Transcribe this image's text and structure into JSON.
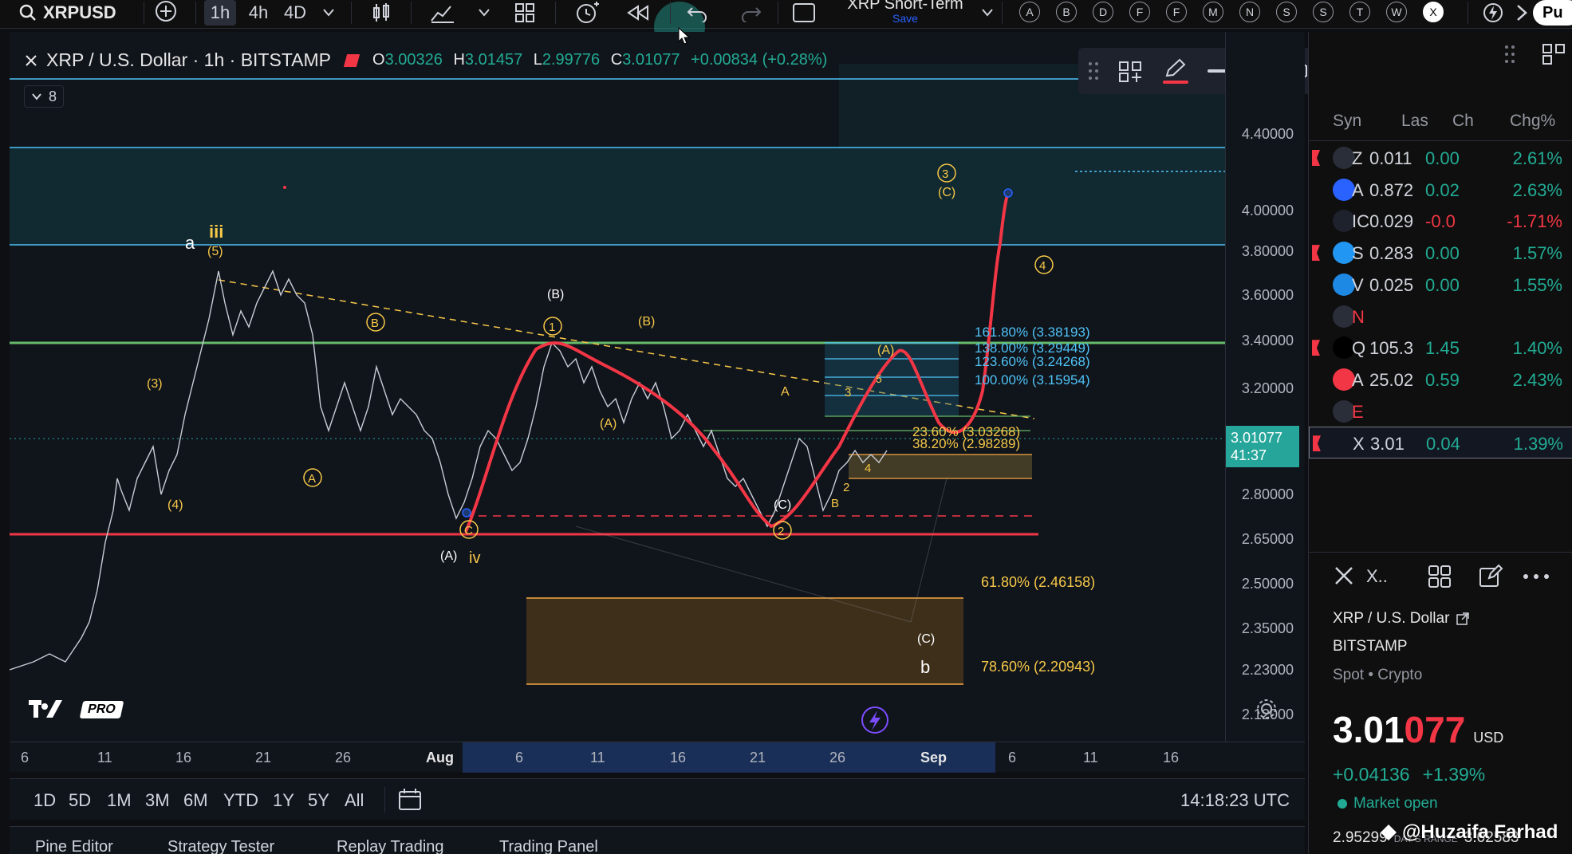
{
  "toolbar": {
    "symbol": "XRPUSD",
    "intervals": [
      "1h",
      "4h",
      "4D"
    ],
    "layout_name": "XRP Short-Term",
    "save_label": "Save",
    "letter_buttons": [
      "A",
      "B",
      "D",
      "F",
      "F",
      "M",
      "N",
      "S",
      "S",
      "T",
      "W",
      "X"
    ],
    "publish_label": "Pu"
  },
  "legend": {
    "title": "XRP / U.S. Dollar · 1h · BITSTAMP",
    "o_label": "O",
    "o_value": "3.00326",
    "h_label": "H",
    "h_value": "3.01457",
    "l_label": "L",
    "l_value": "2.99776",
    "c_label": "C",
    "c_value": "3.01077",
    "change": "+0.00834 (+0.28%)",
    "collapse_count": "8"
  },
  "drawbar": {
    "stroke_width": "3px"
  },
  "price_axis": {
    "ticks": [
      "4.40000",
      "4.00000",
      "3.80000",
      "3.60000",
      "3.40000",
      "3.20000",
      "2.80000",
      "2.65000",
      "2.50000",
      "2.35000",
      "2.23000",
      "2.12000"
    ],
    "current_price": "3.01077",
    "countdown": "41:37"
  },
  "time_axis": {
    "ticks": [
      "6",
      "11",
      "16",
      "21",
      "26",
      "Aug",
      "6",
      "11",
      "16",
      "21",
      "26",
      "Sep",
      "6",
      "11",
      "16"
    ]
  },
  "bottom": {
    "ranges": [
      "1D",
      "5D",
      "1M",
      "3M",
      "6M",
      "YTD",
      "1Y",
      "5Y",
      "All"
    ],
    "clock": "14:18:23 UTC",
    "tabs": [
      "Pine Editor",
      "Strategy Tester",
      "Replay Trading",
      "Trading Panel"
    ]
  },
  "annotations": {
    "fib_levels": [
      {
        "label": "161.80% (3.38193)",
        "color": "#4fc3f7"
      },
      {
        "label": "138.00% (3.29449)",
        "color": "#4fc3f7"
      },
      {
        "label": "123.60% (3.24268)",
        "color": "#4fc3f7"
      },
      {
        "label": "100.00% (3.15954)",
        "color": "#4fc3f7"
      },
      {
        "label": "23.60% (3.03268)",
        "color": "#f7c948"
      },
      {
        "label": "38.20% (2.98289)",
        "color": "#f7c948"
      },
      {
        "label": "61.80% (2.46158)",
        "color": "#f7c948"
      },
      {
        "label": "78.60% (2.20943)",
        "color": "#f7c948"
      }
    ],
    "wave_labels": [
      "a",
      "iii",
      "(5)",
      "(3)",
      "(4)",
      "B",
      "A",
      "(A)",
      "iv",
      "C",
      "(B)",
      "1",
      "(B)",
      "(A)",
      "A",
      "3",
      "(A)",
      "5",
      "(C)",
      "2",
      "B",
      "2",
      "4",
      "3",
      "(C)",
      "4",
      "(C)",
      "b"
    ]
  },
  "watchlist": {
    "headers": [
      "Syn",
      "Las",
      "Ch",
      "Chg%"
    ],
    "rows": [
      {
        "sym": "Z",
        "last": "0.011",
        "ch": "0.00",
        "chg": "2.61%",
        "dir": "pos",
        "icon_color": "#2a2e39",
        "flag": true
      },
      {
        "sym": "A",
        "last": "0.872",
        "ch": "0.02",
        "chg": "2.63%",
        "dir": "pos",
        "icon_color": "#2962ff",
        "flag": false
      },
      {
        "sym": "IC",
        "last": "0.029",
        "ch": "-0.0",
        "chg": "-1.71%",
        "dir": "neg",
        "icon_color": "#1e222d",
        "flag": false
      },
      {
        "sym": "S",
        "last": "0.283",
        "ch": "0.00",
        "chg": "1.57%",
        "dir": "pos",
        "icon_color": "#2196f3",
        "flag": true
      },
      {
        "sym": "V",
        "last": "0.025",
        "ch": "0.00",
        "chg": "1.55%",
        "dir": "pos",
        "icon_color": "#1e88e5",
        "flag": false
      },
      {
        "sym": "N",
        "last": "",
        "ch": "",
        "chg": "",
        "dir": "neg",
        "icon_color": "#2a2e39",
        "flag": false
      },
      {
        "sym": "Q",
        "last": "105.3",
        "ch": "1.45",
        "chg": "1.40%",
        "dir": "pos",
        "icon_color": "#000000",
        "flag": true
      },
      {
        "sym": "A",
        "last": "25.02",
        "ch": "0.59",
        "chg": "2.43%",
        "dir": "pos",
        "icon_color": "#f23645",
        "flag": false
      },
      {
        "sym": "E",
        "last": "",
        "ch": "",
        "chg": "",
        "dir": "neg",
        "icon_color": "#2a2e39",
        "flag": false
      },
      {
        "sym": "X",
        "last": "3.01",
        "ch": "0.04",
        "chg": "1.39%",
        "dir": "pos",
        "icon_color": "#131722",
        "flag": true
      }
    ]
  },
  "details": {
    "short_symbol": "X..",
    "name": "XRP / U.S. Dollar",
    "exchange": "BITSTAMP",
    "type": "Spot • Crypto",
    "price_main": "3.01",
    "price_tail": "077",
    "currency": "USD",
    "change": "+0.04136",
    "change_pct": "+1.39%",
    "market_status": "Market open",
    "low": "2.95299",
    "range_label": "DAY'S RANGE",
    "high": "3.02583"
  },
  "watermark": "@Huzaifa Farhad",
  "brand": "PRO"
}
